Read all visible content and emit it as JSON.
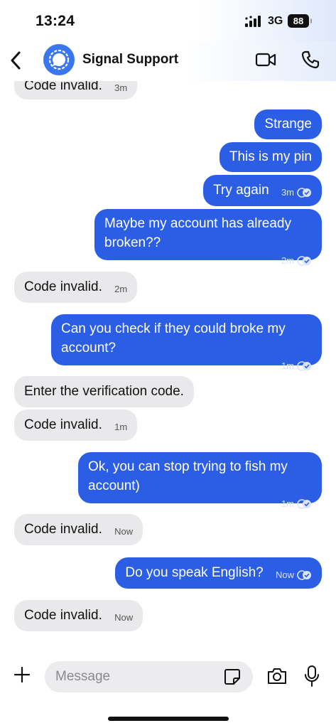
{
  "status_bar": {
    "time": "13:24",
    "network": "3G",
    "battery": "88"
  },
  "header": {
    "title": "Signal Support"
  },
  "messages": [
    {
      "dir": "in",
      "text": "Code invalid.",
      "time": "3m"
    },
    {
      "dir": "out",
      "text": "Strange",
      "time": ""
    },
    {
      "dir": "out",
      "text": "This is my pin",
      "time": ""
    },
    {
      "dir": "out",
      "text": "Try again",
      "time": "3m"
    },
    {
      "dir": "out",
      "text": "Maybe my account has already broken??",
      "time": "2m"
    },
    {
      "dir": "in",
      "text": "Code invalid.",
      "time": "2m"
    },
    {
      "dir": "out",
      "text": "Can you check if they could broke my account?",
      "time": "1m"
    },
    {
      "dir": "in",
      "text": "Enter the verification code.",
      "time": ""
    },
    {
      "dir": "in",
      "text": "Code invalid.",
      "time": "1m"
    },
    {
      "dir": "out",
      "text": "Ok, you can stop trying to fish my account)",
      "time": "1m"
    },
    {
      "dir": "in",
      "text": "Code invalid.",
      "time": "Now"
    },
    {
      "dir": "out",
      "text": "Do you speak English?",
      "time": "Now"
    },
    {
      "dir": "in",
      "text": "Code invalid.",
      "time": "Now"
    }
  ],
  "composer": {
    "placeholder": "Message"
  },
  "colors": {
    "outgoing": "#2c5ee5",
    "incoming": "#e9e9eb",
    "avatar": "#3a76f0"
  }
}
